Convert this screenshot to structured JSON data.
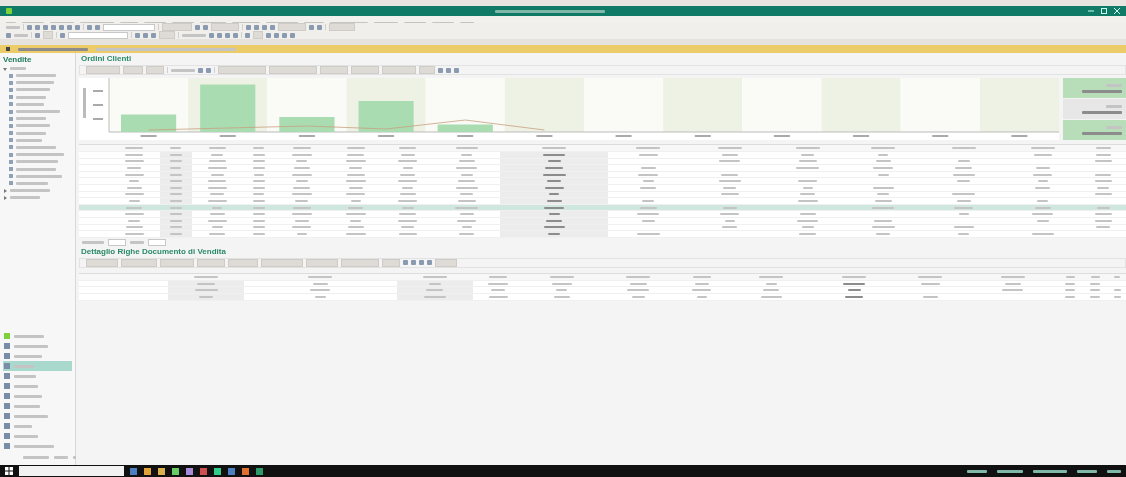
{
  "sidebar": {
    "title": "Vendite",
    "modules": [
      {
        "selected": false
      },
      {
        "selected": false
      },
      {
        "selected": false
      },
      {
        "selected": true
      },
      {
        "selected": false
      },
      {
        "selected": false
      },
      {
        "selected": false
      },
      {
        "selected": false
      },
      {
        "selected": false
      },
      {
        "selected": false
      },
      {
        "selected": false
      },
      {
        "selected": false
      }
    ]
  },
  "orders": {
    "title": "Ordini Clienti",
    "rows": [
      {
        "selected": false
      },
      {
        "selected": false
      },
      {
        "selected": false
      },
      {
        "selected": false
      },
      {
        "selected": false
      },
      {
        "selected": false
      },
      {
        "selected": false
      },
      {
        "selected": false
      },
      {
        "selected": true
      },
      {
        "selected": false
      },
      {
        "selected": false
      },
      {
        "selected": false
      },
      {
        "selected": false
      }
    ]
  },
  "details": {
    "title": "Dettaglio Righe Documento di Vendita"
  }
}
